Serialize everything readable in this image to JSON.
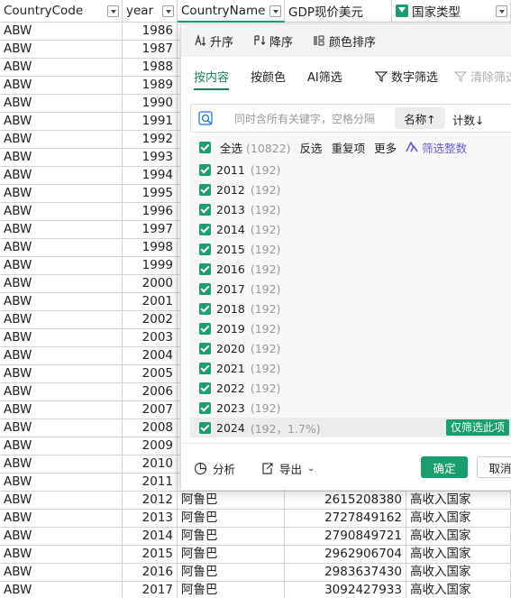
{
  "headers": [
    "CountryCode",
    "year",
    "CountryName",
    "GDP现价美元",
    "国家类型"
  ],
  "rows": [
    {
      "code": "ABW",
      "year": "1986",
      "name": "",
      "gdp": "",
      "type": ""
    },
    {
      "code": "ABW",
      "year": "1987",
      "name": "",
      "gdp": "",
      "type": ""
    },
    {
      "code": "ABW",
      "year": "1988",
      "name": "",
      "gdp": "",
      "type": ""
    },
    {
      "code": "ABW",
      "year": "1989",
      "name": "",
      "gdp": "",
      "type": ""
    },
    {
      "code": "ABW",
      "year": "1990",
      "name": "",
      "gdp": "",
      "type": ""
    },
    {
      "code": "ABW",
      "year": "1991",
      "name": "",
      "gdp": "",
      "type": ""
    },
    {
      "code": "ABW",
      "year": "1992",
      "name": "",
      "gdp": "",
      "type": ""
    },
    {
      "code": "ABW",
      "year": "1993",
      "name": "",
      "gdp": "",
      "type": ""
    },
    {
      "code": "ABW",
      "year": "1994",
      "name": "",
      "gdp": "",
      "type": ""
    },
    {
      "code": "ABW",
      "year": "1995",
      "name": "",
      "gdp": "",
      "type": ""
    },
    {
      "code": "ABW",
      "year": "1996",
      "name": "",
      "gdp": "",
      "type": ""
    },
    {
      "code": "ABW",
      "year": "1997",
      "name": "",
      "gdp": "",
      "type": ""
    },
    {
      "code": "ABW",
      "year": "1998",
      "name": "",
      "gdp": "",
      "type": ""
    },
    {
      "code": "ABW",
      "year": "1999",
      "name": "",
      "gdp": "",
      "type": ""
    },
    {
      "code": "ABW",
      "year": "2000",
      "name": "",
      "gdp": "",
      "type": ""
    },
    {
      "code": "ABW",
      "year": "2001",
      "name": "",
      "gdp": "",
      "type": ""
    },
    {
      "code": "ABW",
      "year": "2002",
      "name": "",
      "gdp": "",
      "type": ""
    },
    {
      "code": "ABW",
      "year": "2003",
      "name": "",
      "gdp": "",
      "type": ""
    },
    {
      "code": "ABW",
      "year": "2004",
      "name": "",
      "gdp": "",
      "type": ""
    },
    {
      "code": "ABW",
      "year": "2005",
      "name": "",
      "gdp": "",
      "type": ""
    },
    {
      "code": "ABW",
      "year": "2006",
      "name": "",
      "gdp": "",
      "type": ""
    },
    {
      "code": "ABW",
      "year": "2007",
      "name": "",
      "gdp": "",
      "type": ""
    },
    {
      "code": "ABW",
      "year": "2008",
      "name": "",
      "gdp": "",
      "type": ""
    },
    {
      "code": "ABW",
      "year": "2009",
      "name": "",
      "gdp": "",
      "type": ""
    },
    {
      "code": "ABW",
      "year": "2010",
      "name": "",
      "gdp": "",
      "type": ""
    },
    {
      "code": "ABW",
      "year": "2011",
      "name": "",
      "gdp": "",
      "type": ""
    },
    {
      "code": "ABW",
      "year": "2012",
      "name": "阿鲁巴",
      "gdp": "2615208380",
      "type": "高收入国家"
    },
    {
      "code": "ABW",
      "year": "2013",
      "name": "阿鲁巴",
      "gdp": "2727849162",
      "type": "高收入国家"
    },
    {
      "code": "ABW",
      "year": "2014",
      "name": "阿鲁巴",
      "gdp": "2790849721",
      "type": "高收入国家"
    },
    {
      "code": "ABW",
      "year": "2015",
      "name": "阿鲁巴",
      "gdp": "2962906704",
      "type": "高收入国家"
    },
    {
      "code": "ABW",
      "year": "2016",
      "name": "阿鲁巴",
      "gdp": "2983637430",
      "type": "高收入国家"
    },
    {
      "code": "ABW",
      "year": "2017",
      "name": "阿鲁巴",
      "gdp": "3092427933",
      "type": "高收入国家"
    }
  ],
  "popup": {
    "sort_asc": "升序",
    "sort_desc": "降序",
    "sort_color": "颜色排序",
    "tab_content": "按内容",
    "tab_color": "按颜色",
    "tab_ai": "AI筛选",
    "number_filter": "数字筛选",
    "clear_filter": "清除筛选",
    "search_placeholder": "同时含所有关键字，空格分隔",
    "sort_by_name": "名称↑",
    "sort_by_count": "计数↓",
    "select_all": "全选",
    "select_all_count": "(10822)",
    "invert": "反选",
    "duplicates": "重复项",
    "more": "更多",
    "filter_int": "筛选整数",
    "items": [
      {
        "label": "2011",
        "count": "(192)"
      },
      {
        "label": "2012",
        "count": "(192)"
      },
      {
        "label": "2013",
        "count": "(192)"
      },
      {
        "label": "2014",
        "count": "(192)"
      },
      {
        "label": "2015",
        "count": "(192)"
      },
      {
        "label": "2016",
        "count": "(192)"
      },
      {
        "label": "2017",
        "count": "(192)"
      },
      {
        "label": "2018",
        "count": "(192)"
      },
      {
        "label": "2019",
        "count": "(192)"
      },
      {
        "label": "2020",
        "count": "(192)"
      },
      {
        "label": "2021",
        "count": "(192)"
      },
      {
        "label": "2022",
        "count": "(192)"
      },
      {
        "label": "2023",
        "count": "(192)"
      },
      {
        "label": "2024",
        "count": "(192，1.7%)"
      }
    ],
    "only_this": "仅筛选此项",
    "analysis": "分析",
    "export": "导出",
    "ok": "确定",
    "cancel": "取消"
  }
}
